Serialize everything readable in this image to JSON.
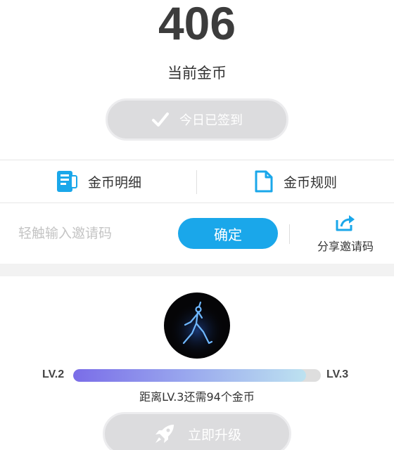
{
  "coins": {
    "count": "406",
    "label": "当前金币"
  },
  "checkin": {
    "label": "今日已签到",
    "icon": "checkmark-icon"
  },
  "links": {
    "detail": {
      "label": "金币明细",
      "icon": "document-list-icon",
      "color": "#1aa7ea"
    },
    "rules": {
      "label": "金币规则",
      "icon": "file-icon",
      "color": "#1aa7ea"
    }
  },
  "invite": {
    "placeholder": "轻触输入邀请码",
    "confirm_label": "确定",
    "share_label": "分享邀请码",
    "share_icon": "share-icon",
    "accent": "#1aa7ea"
  },
  "level": {
    "current": "LV.2",
    "next": "LV.3",
    "progress": 0.94,
    "need_text": "距离LV.3还需94个金币",
    "avatar_icon": "jumpman-logo-icon"
  },
  "upgrade": {
    "label": "立即升级",
    "icon": "rocket-icon"
  }
}
